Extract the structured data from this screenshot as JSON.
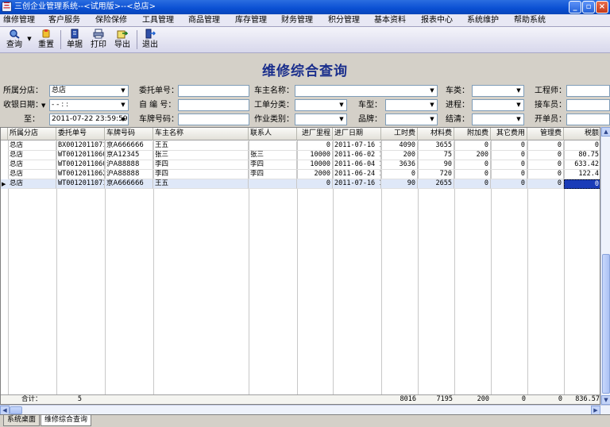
{
  "window": {
    "title": "三创企业管理系统--<试用版>--<总店>"
  },
  "menu": [
    "维修管理",
    "客户服务",
    "保险保修",
    "工具管理",
    "商品管理",
    "库存管理",
    "财务管理",
    "积分管理",
    "基本资料",
    "报表中心",
    "系统维护",
    "帮助系统"
  ],
  "toolbar": {
    "query": "查询",
    "reset": "重置",
    "document": "单据",
    "print": "打印",
    "export": "导出",
    "exit": "退出"
  },
  "page": {
    "title": "维修综合查询"
  },
  "form": {
    "branch_label": "所属分店：",
    "branch_value": "总店",
    "order_no_label": "委托单号：",
    "order_no_value": "",
    "owner_label": "车主名称：",
    "owner_value": "",
    "car_class_label": "车类：",
    "car_class_value": "",
    "engineer_label": "工程师：",
    "cash_date_label": "收银日期：",
    "cash_date_value": "- -   : :",
    "self_no_label": "自 编 号：",
    "self_no_value": "",
    "order_type_label": "工单分类：",
    "order_type_value": "",
    "car_model_label": "车型：",
    "car_model_value": "",
    "progress_label": "进程：",
    "progress_value": "",
    "receiver_label": "接车员：",
    "to_label": "至：",
    "to_value": "2011-07-22 23:59:59",
    "plate_label": "车牌号码：",
    "plate_value": "",
    "work_type_label": "作业类别：",
    "work_type_value": "",
    "brand_label": "品牌：",
    "brand_value": "",
    "settle_label": "结清：",
    "settle_value": "",
    "clerk_label": "开单员："
  },
  "grid": {
    "headers": [
      "所属分店",
      "委托单号",
      "车牌号码",
      "车主名称",
      "联系人",
      "进厂里程",
      "进厂日期",
      "工时费",
      "材料费",
      "附加费",
      "其它费用",
      "管理费",
      "税额"
    ],
    "rows": [
      [
        "总店",
        "BX00120110716",
        "京A666666",
        "王五",
        "",
        "0",
        "2011-07-16 13",
        "4090",
        "3655",
        "0",
        "0",
        "0",
        "0"
      ],
      [
        "总店",
        "WT00120110602",
        "京A12345",
        "张三",
        "张三",
        "10000",
        "2011-06-02 11",
        "200",
        "75",
        "200",
        "0",
        "0",
        "80.75"
      ],
      [
        "总店",
        "WT00120110604",
        "沪A88888",
        "李四",
        "李四",
        "10000",
        "2011-06-04 16",
        "3636",
        "90",
        "0",
        "0",
        "0",
        "633.42"
      ],
      [
        "总店",
        "WT00120110624",
        "沪A88888",
        "李四",
        "李四",
        "2000",
        "2011-06-24 19",
        "0",
        "720",
        "0",
        "0",
        "0",
        "122.4"
      ],
      [
        "总店",
        "WT00120110716",
        "京A666666",
        "王五",
        "",
        "0",
        "2011-07-16 13",
        "90",
        "2655",
        "0",
        "0",
        "0",
        "0"
      ]
    ],
    "footer": {
      "label": "合计：",
      "count": "5",
      "labor": "8016",
      "material": "7195",
      "extra": "200",
      "other": "0",
      "mgmt": "0",
      "tax": "836.57"
    }
  },
  "tabs": [
    "系统桌面",
    "维修综合查询"
  ]
}
